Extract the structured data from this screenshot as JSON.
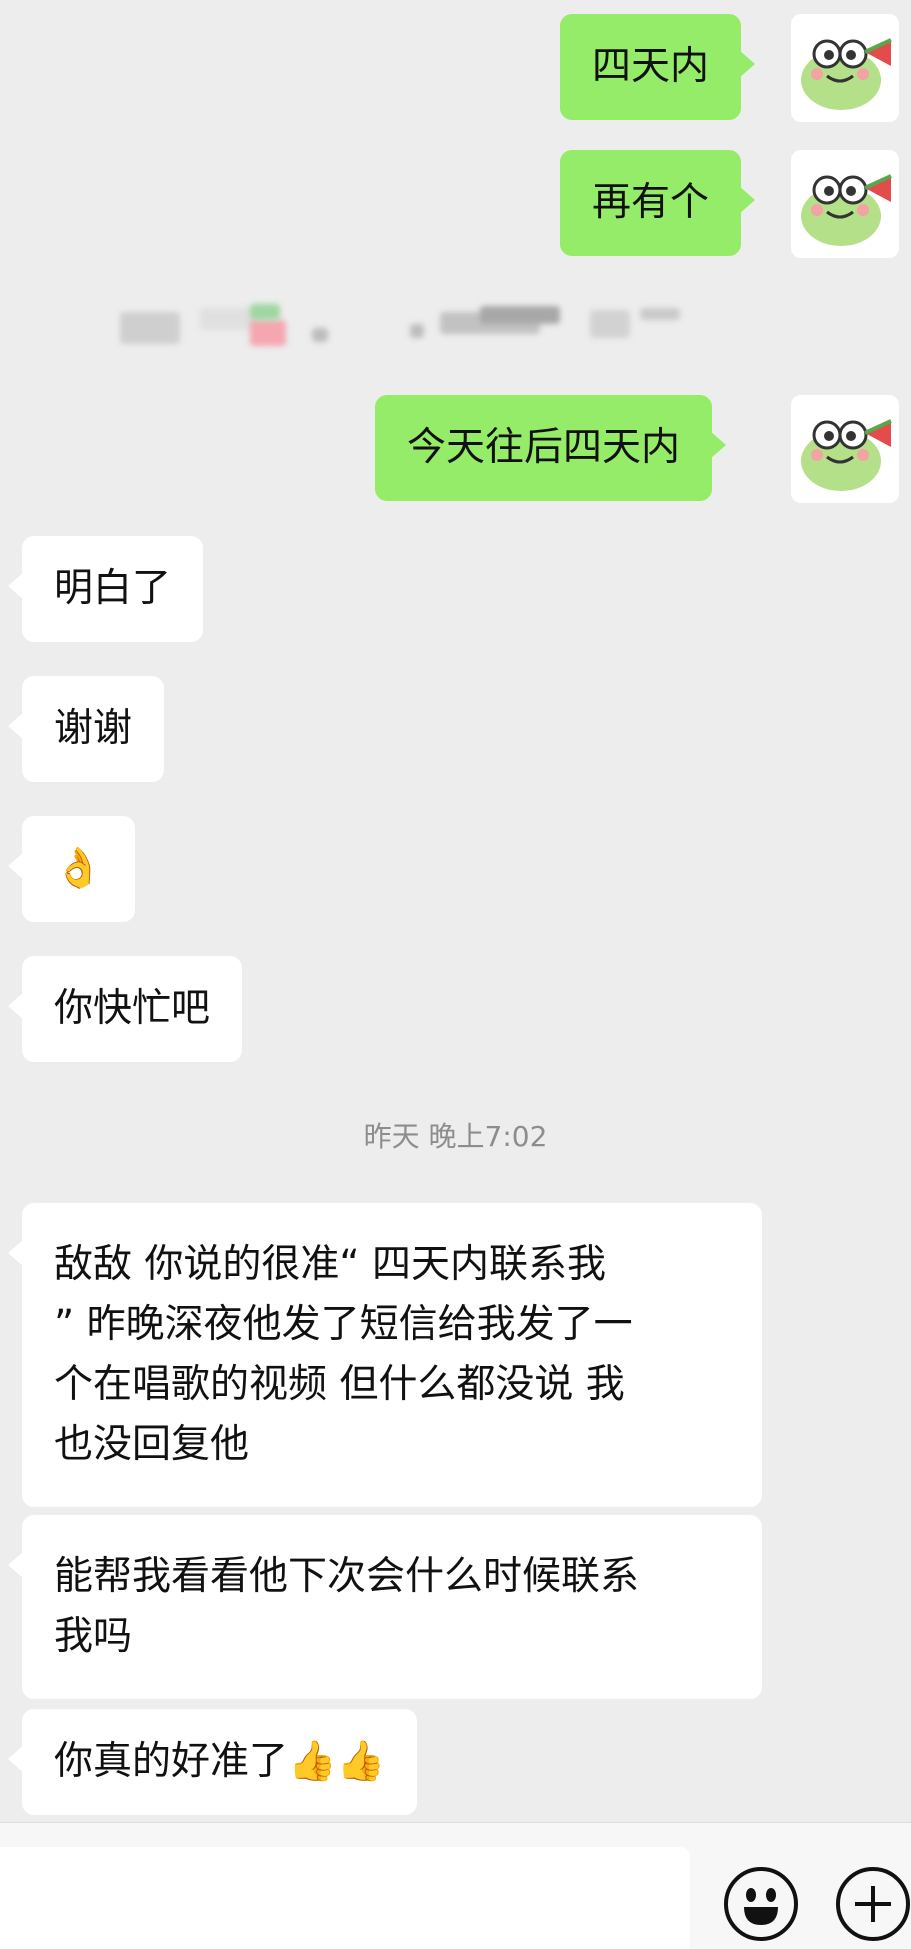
{
  "messages": {
    "m1": "四天内",
    "m2": "再有个",
    "m3": "今天往后四天内",
    "m4": "明白了",
    "m5": "谢谢",
    "m6": "👌",
    "m7": "你快忙吧",
    "m8": "敌敌 你说的很准“ 四天内联系我\n” 昨晚深夜他发了短信给我发了一\n个在唱歌的视频 但什么都没说 我\n也没回复他",
    "m9": "能帮我看看他下次会什么时候联系\n我吗",
    "m10": "你真的好准了👍👍"
  },
  "timestamp": "昨天 晚上7:02",
  "colors": {
    "outgoing": "#95ec69",
    "incoming": "#ffffff",
    "background": "#ededed"
  },
  "icons": {
    "emoji_button": "emoji-face-icon",
    "plus_button": "plus-icon",
    "avatar": "frog-sticker-avatar"
  }
}
